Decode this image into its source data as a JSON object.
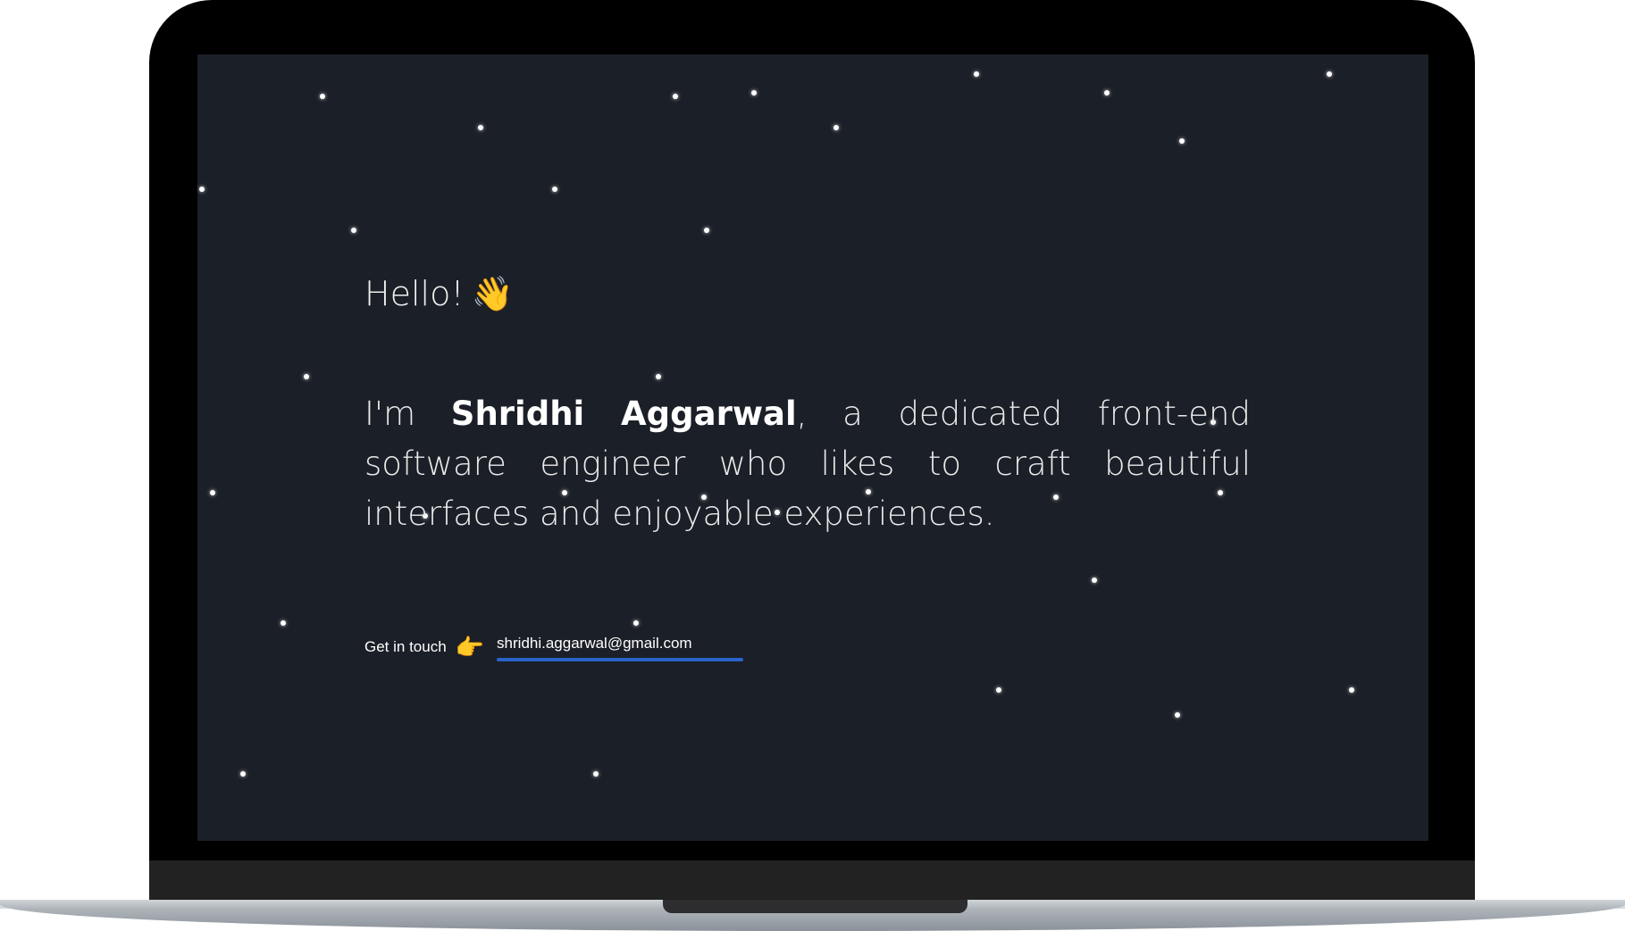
{
  "hero": {
    "greeting": "Hello!",
    "wave_icon": "waving-hand-icon",
    "intro_prefix": "I'm ",
    "name": "Shridhi Aggarwal",
    "intro_suffix": ", a dedicated front-end software engineer who likes to craft beautiful interfaces and enjoyable experiences."
  },
  "contact": {
    "label": "Get in touch",
    "pointer_icon": "pointing-right-icon",
    "email": "shridhi.aggarwal@gmail.com",
    "underline_color": "#2a63c9"
  },
  "theme": {
    "background": "#1b1f27",
    "star_color": "#ffffff"
  }
}
